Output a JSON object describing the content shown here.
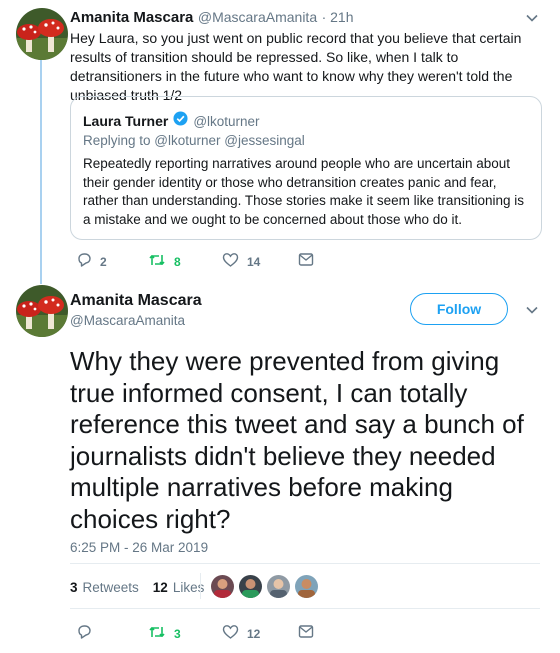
{
  "reply_tweet": {
    "author_name": "Amanita Mascara",
    "author_handle": "@MascaraAmanita",
    "timestamp": "· 21h",
    "text": "Hey Laura, so you just went on public record that you believe that certain results of transition should be repressed. So like, when I talk to detransitioners in the future who want to know why they weren't told the unbiased truth 1/2",
    "quote": {
      "author_name": "Laura Turner",
      "author_handle": "@lkoturner",
      "replying_to": "Replying to @lkoturner @jessesingal",
      "text": "Repeatedly reporting narratives around people who are uncertain about their gender identity or those who detransition creates panic and fear, rather than understanding. Those stories make it seem like transitioning is a mistake and we ought to be concerned about those who do it."
    },
    "actions": {
      "replies": "2",
      "retweets": "8",
      "likes": "14"
    }
  },
  "main_tweet": {
    "author_name": "Amanita Mascara",
    "author_handle": "@MascaraAmanita",
    "follow_label": "Follow",
    "text": "Why they were prevented from giving true informed consent, I can totally reference this tweet and say a bunch of journalists didn't believe they needed multiple narratives before making choices right?",
    "datetime": "6:25 PM - 26 Mar 2019",
    "stats": {
      "retweets_count": "3",
      "retweets_label": "Retweets",
      "likes_count": "12",
      "likes_label": "Likes"
    },
    "actions": {
      "replies": "",
      "retweets": "3",
      "likes": "12"
    }
  },
  "colors": {
    "accent": "#1da1f2",
    "retweet": "#17bf63",
    "muted": "#657786",
    "verified": "#1da1f2"
  },
  "icons": [
    "chevron-down-icon",
    "verified-badge-icon",
    "reply-icon",
    "retweet-icon",
    "like-icon",
    "dm-icon"
  ]
}
